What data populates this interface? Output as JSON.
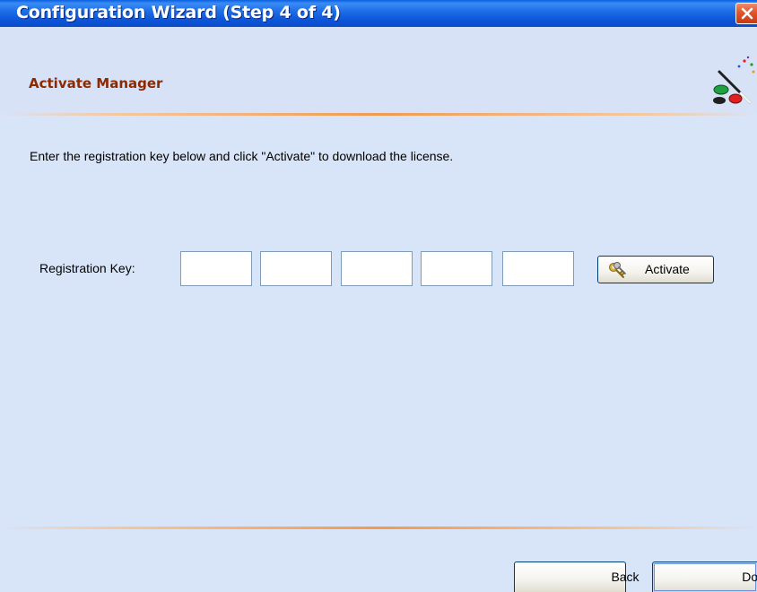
{
  "window": {
    "title": "Configuration Wizard (Step 4 of 4)"
  },
  "header": {
    "title": "Activate Manager",
    "icon": "wizard-wand-icon"
  },
  "main": {
    "instructions": "Enter the registration key below and click \"Activate\" to download the license.",
    "registration_label": "Registration Key:",
    "key_fields": [
      {
        "value": ""
      },
      {
        "value": ""
      },
      {
        "value": ""
      },
      {
        "value": ""
      },
      {
        "value": ""
      }
    ],
    "activate_label": "Activate",
    "activate_icon": "keys-icon"
  },
  "footer": {
    "back_label": "Back",
    "done_label": "Done"
  },
  "colors": {
    "titlebar": "#0a55d8",
    "header_title": "#8b2a00",
    "panel_background": "#d8e4f8",
    "divider": "#f29a50",
    "close_button": "#e2552c"
  }
}
